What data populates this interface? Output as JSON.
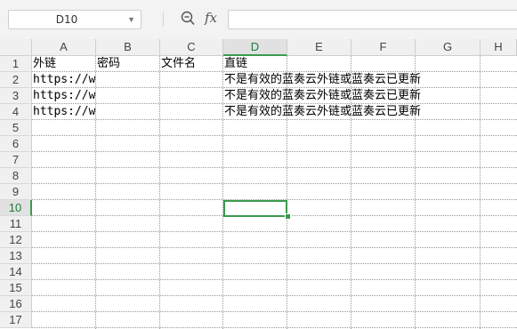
{
  "formula_bar": {
    "name_box": "D10",
    "fx_label": "fx",
    "formula": ""
  },
  "sheet": {
    "columns": [
      "A",
      "B",
      "C",
      "D",
      "E",
      "F",
      "G",
      "H"
    ],
    "rows": [
      "1",
      "2",
      "3",
      "4",
      "5",
      "6",
      "7",
      "8",
      "9",
      "10",
      "11",
      "12",
      "13",
      "14",
      "15",
      "16",
      "17"
    ],
    "selected_column": "D",
    "selected_row": "10",
    "selected_cell": "D10",
    "cells": {
      "A1": "外链",
      "B1": "密码",
      "C1": "文件名",
      "D1": "直链",
      "A2": "https://w",
      "D2": "不是有效的蓝奏云外链或蓝奏云已更新",
      "A3": "https://w",
      "D3": "不是有效的蓝奏云外链或蓝奏云已更新",
      "A4": "https://w",
      "D4": "不是有效的蓝奏云外链或蓝奏云已更新"
    }
  },
  "icons": {
    "zoom": "zoom-search-icon",
    "dropdown": "chevron-down-icon",
    "function": "fx-icon"
  },
  "colors": {
    "selection": "#3a9a4e",
    "header_bg": "#f0f0f0"
  }
}
